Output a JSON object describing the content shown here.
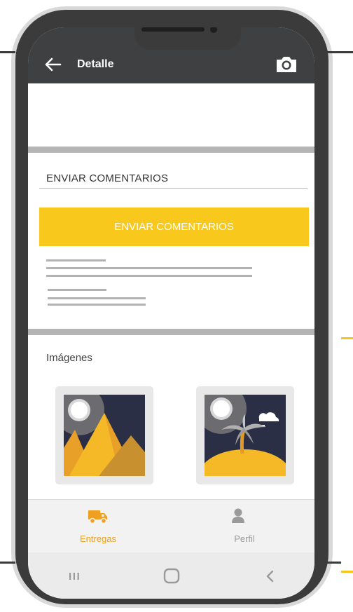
{
  "appbar": {
    "title": "Detalle",
    "back_icon": "arrow-left-icon",
    "camera_icon": "camera-icon"
  },
  "feedback": {
    "input_label": "ENVIAR COMENTARIOS",
    "button_label": "ENVIAR COMENTARIOS",
    "button_color": "#f8c81c"
  },
  "images_section": {
    "title": "Imágenes",
    "items": [
      "pyramids-image",
      "island-image"
    ]
  },
  "bottom_nav": {
    "items": [
      {
        "label": "Entregas",
        "icon": "truck-icon",
        "active": true,
        "color": "#f0a020"
      },
      {
        "label": "Perfil",
        "icon": "person-icon",
        "active": false,
        "color": "#9a9a9a"
      }
    ]
  },
  "system_nav": {
    "icons": [
      "recents-icon",
      "home-icon",
      "back-icon"
    ]
  },
  "colors": {
    "appbar": "#3f4041",
    "accent": "#f8c81c",
    "active_tab": "#f0a020"
  }
}
